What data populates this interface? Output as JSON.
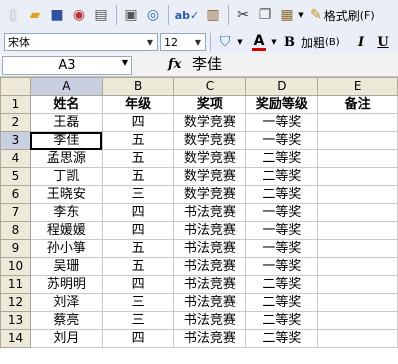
{
  "toolbar1": {
    "icons": [
      "new-icon",
      "open-icon",
      "save-icon",
      "permission-icon",
      "print-icon",
      "print-preview-icon",
      "research-icon",
      "spelling-icon",
      "cut-icon",
      "copy-icon",
      "paste-icon",
      "format-painter-icon"
    ],
    "format_painter_label": "格式刷",
    "format_painter_key": "(F)"
  },
  "toolbar2": {
    "font_name": "宋体",
    "font_size": "12",
    "bold_glyph": "B",
    "bold_label": "加粗",
    "bold_key": "(B)",
    "italic_glyph": "I",
    "underline_glyph": "U",
    "font_color_glyph": "A",
    "font_color": "#d00000"
  },
  "formula_bar": {
    "name_box": "A3",
    "fx": "fx",
    "value": "李佳"
  },
  "columns": [
    "A",
    "B",
    "C",
    "D",
    "E"
  ],
  "rows": [
    "1",
    "2",
    "3",
    "4",
    "5",
    "6",
    "7",
    "8",
    "9",
    "10",
    "11",
    "12",
    "13",
    "14"
  ],
  "sheet": [
    [
      "姓名",
      "年级",
      "奖项",
      "奖励等级",
      "备注"
    ],
    [
      "王磊",
      "四",
      "数学竞赛",
      "一等奖",
      ""
    ],
    [
      "李佳",
      "五",
      "数学竞赛",
      "一等奖",
      ""
    ],
    [
      "孟思源",
      "五",
      "数学竞赛",
      "二等奖",
      ""
    ],
    [
      "丁凯",
      "五",
      "数学竞赛",
      "二等奖",
      ""
    ],
    [
      "王晓安",
      "三",
      "数学竞赛",
      "二等奖",
      ""
    ],
    [
      "李东",
      "四",
      "书法竞赛",
      "一等奖",
      ""
    ],
    [
      "程媛媛",
      "四",
      "书法竞赛",
      "一等奖",
      ""
    ],
    [
      "孙小箏",
      "五",
      "书法竞赛",
      "一等奖",
      ""
    ],
    [
      "吴珊",
      "五",
      "书法竞赛",
      "一等奖",
      ""
    ],
    [
      "苏明明",
      "四",
      "书法竞赛",
      "二等奖",
      ""
    ],
    [
      "刘泽",
      "三",
      "书法竞赛",
      "二等奖",
      ""
    ],
    [
      "蔡亮",
      "三",
      "书法竞赛",
      "二等奖",
      ""
    ],
    [
      "刘月",
      "四",
      "书法竞赛",
      "二等奖",
      ""
    ]
  ]
}
